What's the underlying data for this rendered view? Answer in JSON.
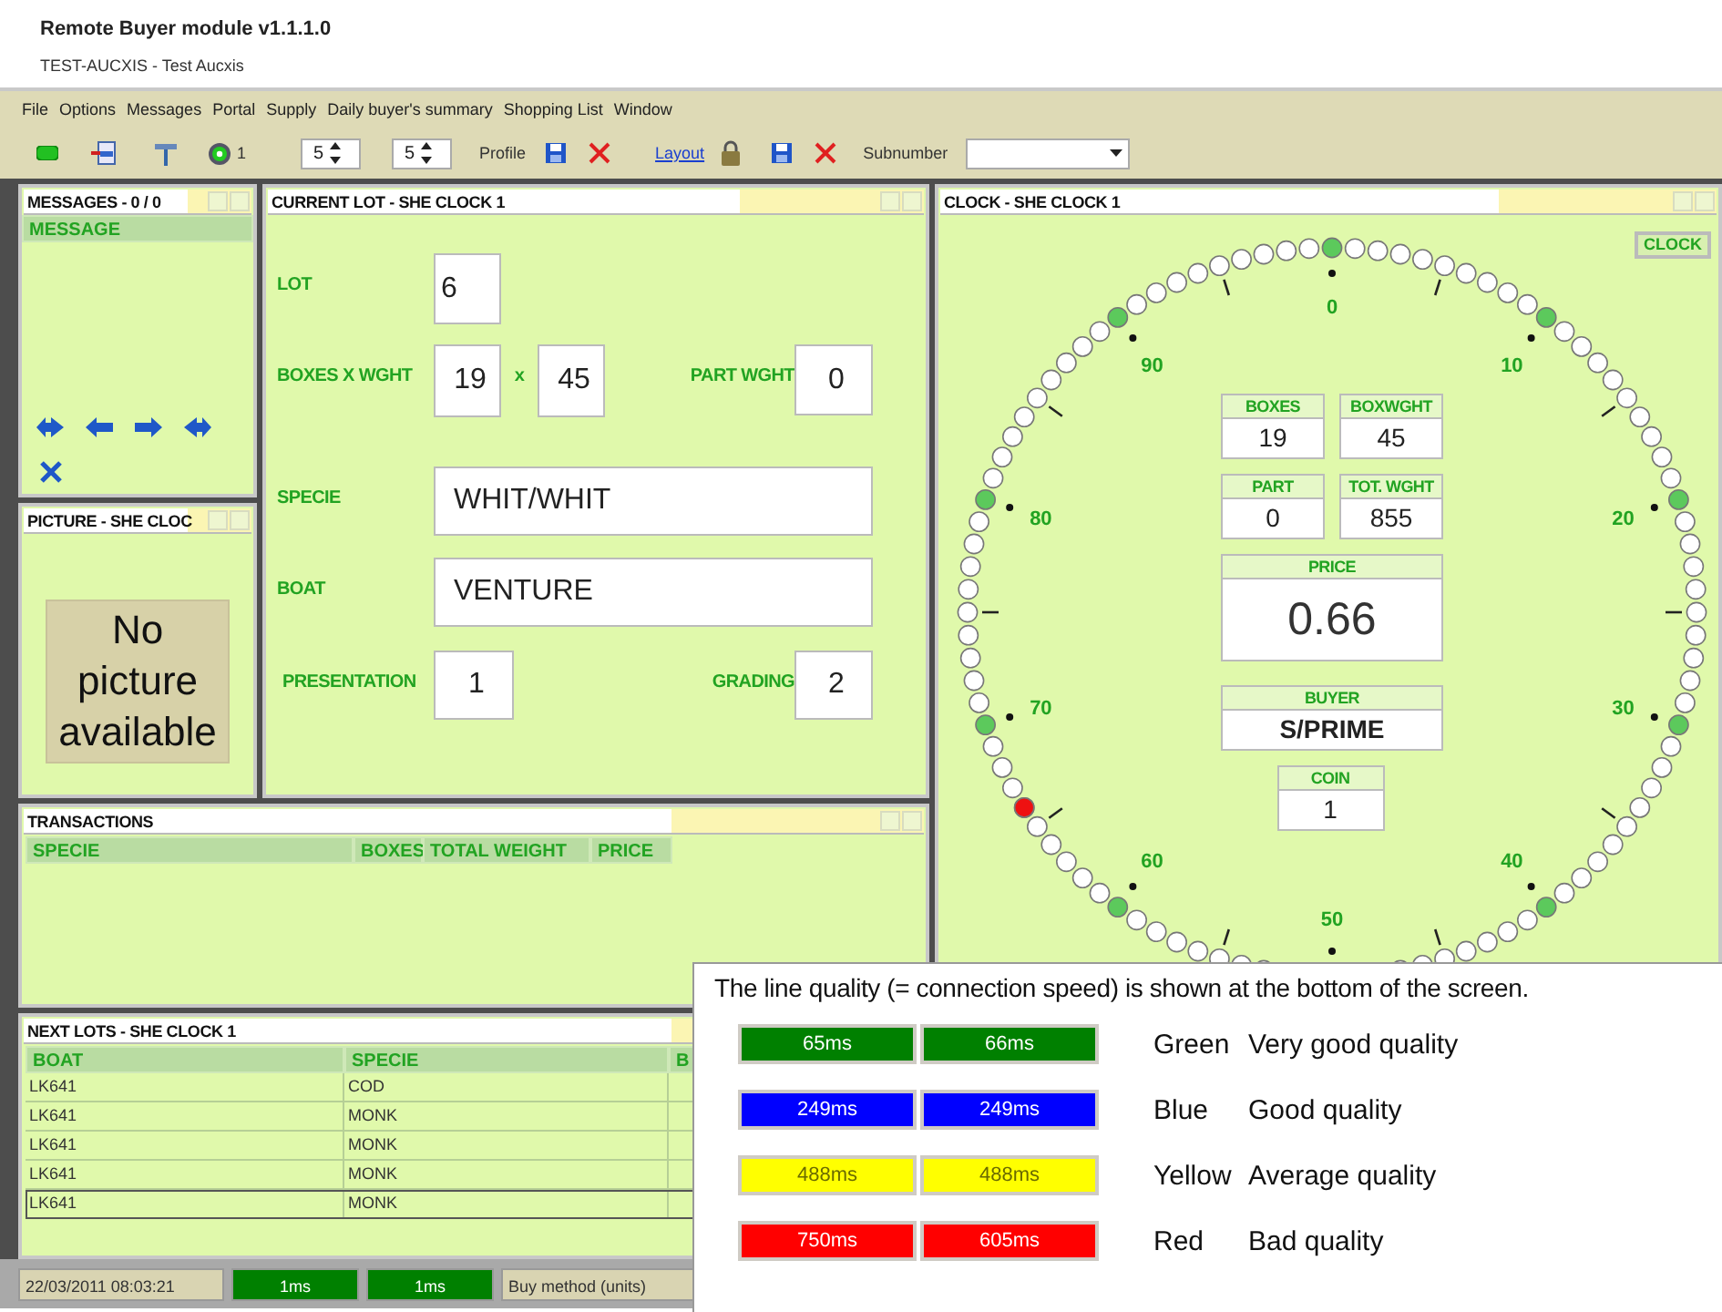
{
  "window": {
    "title": "Remote Buyer module v1.1.1.0",
    "subtitle": "TEST-AUCXIS - Test Aucxis"
  },
  "menu": [
    "File",
    "Options",
    "Messages",
    "Portal",
    "Supply",
    "Daily buyer's summary",
    "Shopping List",
    "Window"
  ],
  "toolbar": {
    "clock_count": "1",
    "spinners": [
      "5",
      "5"
    ],
    "profile_label": "Profile",
    "layout_link": "Layout",
    "subnumber_label": "Subnumber"
  },
  "messages": {
    "title": "MESSAGES - 0 / 0",
    "column": "MESSAGE"
  },
  "picture": {
    "title": "PICTURE - SHE CLOC",
    "placeholder": "No picture available"
  },
  "current_lot": {
    "title": "CURRENT LOT - SHE CLOCK 1",
    "lot": {
      "label": "LOT",
      "value": "6"
    },
    "boxes": {
      "label": "BOXES X WGHT",
      "value": "19"
    },
    "times": "x",
    "weight": {
      "value": "45"
    },
    "part_weight": {
      "label": "PART WGHT",
      "value": "0"
    },
    "specie": {
      "label": "SPECIE",
      "value": "WHIT/WHIT"
    },
    "boat": {
      "label": "BOAT",
      "value": "VENTURE"
    },
    "presentation": {
      "label": "PRESENTATION",
      "value": "1"
    },
    "grading": {
      "label": "GRADING",
      "value": "2"
    }
  },
  "clock": {
    "title": "CLOCK - SHE CLOCK 1",
    "button": "CLOCK",
    "labels": [
      "0",
      "10",
      "20",
      "30",
      "40",
      "50",
      "60",
      "70",
      "80",
      "90"
    ],
    "info": [
      {
        "kind": "pair",
        "label": "BOXES",
        "value": "19"
      },
      {
        "kind": "pair",
        "label": "BOXWGHT",
        "value": "45"
      },
      {
        "kind": "pair",
        "label": "PART",
        "value": "0"
      },
      {
        "kind": "pair",
        "label": "TOT. WGHT",
        "value": "855"
      },
      {
        "kind": "price",
        "label": "PRICE",
        "value": "0.66"
      },
      {
        "kind": "wide",
        "label": "BUYER",
        "value": "S/PRIME"
      },
      {
        "kind": "coin",
        "label": "COIN",
        "value": "1"
      }
    ]
  },
  "transactions": {
    "title": "TRANSACTIONS",
    "columns": [
      "SPECIE",
      "BOXES",
      "TOTAL WEIGHT",
      "PRICE"
    ]
  },
  "next_lots": {
    "title": "NEXT LOTS - SHE CLOCK 1",
    "columns": [
      "BOAT",
      "SPECIE",
      "B"
    ],
    "rows": [
      {
        "boat": "LK641",
        "specie": "COD",
        "selected": false
      },
      {
        "boat": "LK641",
        "specie": "MONK",
        "selected": false
      },
      {
        "boat": "LK641",
        "specie": "MONK",
        "selected": false
      },
      {
        "boat": "LK641",
        "specie": "MONK",
        "selected": false
      },
      {
        "boat": "LK641",
        "specie": "MONK",
        "selected": true
      }
    ]
  },
  "status_bar": {
    "datetime": "22/03/2011 08:03:21",
    "pings": [
      {
        "text": "1ms",
        "color": "#008000"
      },
      {
        "text": "1ms",
        "color": "#008000"
      }
    ],
    "method": "Buy method (units)"
  },
  "legend": {
    "caption": "The line quality (= connection speed) is shown at the bottom of the screen.",
    "rows": [
      {
        "pings": [
          "65ms",
          "66ms"
        ],
        "color": "#008000",
        "color_name": "Green",
        "meaning": "Very good quality"
      },
      {
        "pings": [
          "249ms",
          "249ms"
        ],
        "color": "#0000ff",
        "color_name": "Blue",
        "meaning": "Good quality"
      },
      {
        "pings": [
          "488ms",
          "488ms"
        ],
        "color": "#ffff00",
        "color_name": "Yellow",
        "meaning": "Average quality"
      },
      {
        "pings": [
          "750ms",
          "605ms"
        ],
        "color": "#ff0000",
        "color_name": "Red",
        "meaning": "Bad quality"
      }
    ]
  }
}
